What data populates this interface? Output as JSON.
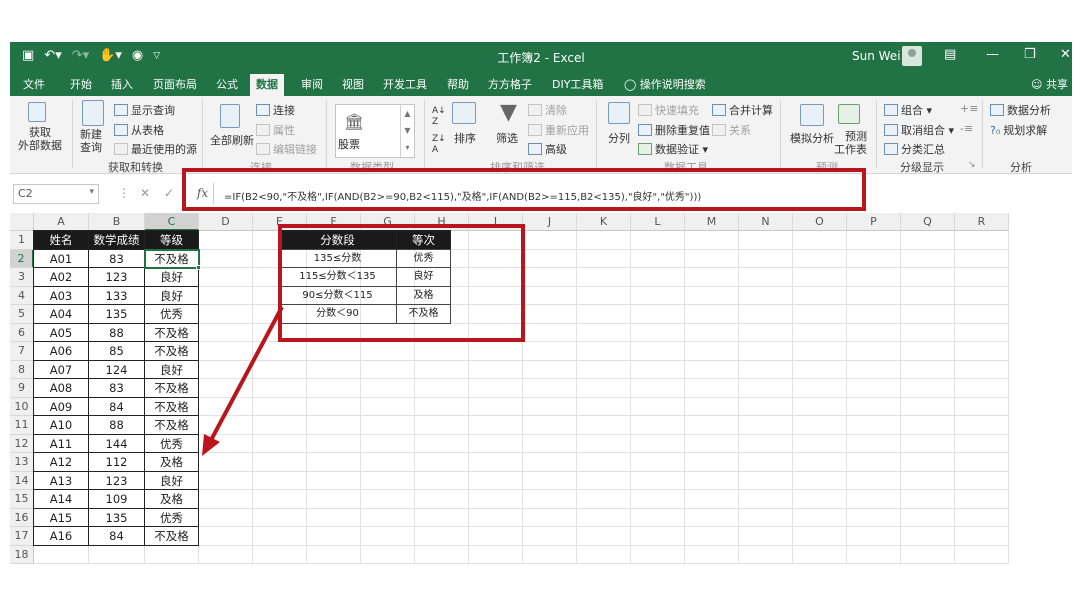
{
  "window": {
    "title": "工作簿2 - Excel",
    "user": "Sun Wei"
  },
  "tabs": [
    "文件",
    "开始",
    "插入",
    "页面布局",
    "公式",
    "数据",
    "审阅",
    "视图",
    "开发工具",
    "帮助",
    "方方格子",
    "DIY工具箱"
  ],
  "active_tab": "数据",
  "tell_me": "操作说明搜索",
  "share": "共享",
  "ribbon": {
    "get_data": "获取\n外部数据",
    "new_query": "新建\n查询",
    "show_queries": "显示查询",
    "from_table": "从表格",
    "recent_sources": "最近使用的源",
    "group_get_transform": "获取和转换",
    "refresh_all": "全部刷新",
    "connections": "连接",
    "properties": "属性",
    "edit_links": "编辑链接",
    "group_connections": "连接",
    "stocks": "股票",
    "group_data_types": "数据类型",
    "sort": "排序",
    "filter": "筛选",
    "clear": "清除",
    "reapply": "重新应用",
    "advanced": "高级",
    "group_sort_filter": "排序和筛选",
    "text_to_columns": "分列",
    "flash_fill": "快速填充",
    "remove_duplicates": "删除重复值",
    "data_validation": "数据验证",
    "consolidate": "合并计算",
    "relationships": "关系",
    "group_data_tools": "数据工具",
    "what_if": "模拟分析",
    "forecast_sheet": "预测\n工作表",
    "group_forecast": "预测",
    "group": "组合",
    "ungroup": "取消组合",
    "subtotal": "分类汇总",
    "group_outline": "分级显示",
    "data_analysis": "数据分析",
    "solver": "规划求解",
    "group_analysis": "分析"
  },
  "formula_bar": {
    "name_box": "C2",
    "formula": "=IF(B2<90,\"不及格\",IF(AND(B2>=90,B2<115),\"及格\",IF(AND(B2>=115,B2<135),\"良好\",\"优秀\")))"
  },
  "columns": [
    "A",
    "B",
    "C",
    "D",
    "E",
    "F",
    "G",
    "H",
    "I",
    "J",
    "K",
    "L",
    "M",
    "N",
    "O",
    "P",
    "Q",
    "R"
  ],
  "rows": [
    "1",
    "2",
    "3",
    "4",
    "5",
    "6",
    "7",
    "8",
    "9",
    "10",
    "11",
    "12",
    "13",
    "14",
    "15",
    "16",
    "17",
    "18"
  ],
  "table": {
    "headers": [
      "姓名",
      "数学成绩",
      "等级"
    ],
    "rows": [
      [
        "A01",
        "83",
        "不及格"
      ],
      [
        "A02",
        "123",
        "良好"
      ],
      [
        "A03",
        "133",
        "良好"
      ],
      [
        "A04",
        "135",
        "优秀"
      ],
      [
        "A05",
        "88",
        "不及格"
      ],
      [
        "A06",
        "85",
        "不及格"
      ],
      [
        "A07",
        "124",
        "良好"
      ],
      [
        "A08",
        "83",
        "不及格"
      ],
      [
        "A09",
        "84",
        "不及格"
      ],
      [
        "A10",
        "88",
        "不及格"
      ],
      [
        "A11",
        "144",
        "优秀"
      ],
      [
        "A12",
        "112",
        "及格"
      ],
      [
        "A13",
        "123",
        "良好"
      ],
      [
        "A14",
        "109",
        "及格"
      ],
      [
        "A15",
        "135",
        "优秀"
      ],
      [
        "A16",
        "84",
        "不及格"
      ]
    ]
  },
  "reference": {
    "headers": [
      "分数段",
      "等次"
    ],
    "rows": [
      [
        "135≤分数",
        "优秀"
      ],
      [
        "115≤分数＜135",
        "良好"
      ],
      [
        "90≤分数＜115",
        "及格"
      ],
      [
        "分数＜90",
        "不及格"
      ]
    ]
  },
  "colors": {
    "excel_green": "#217346",
    "annotation_red": "#b8151c",
    "header_fill": "#1a1a1a"
  }
}
